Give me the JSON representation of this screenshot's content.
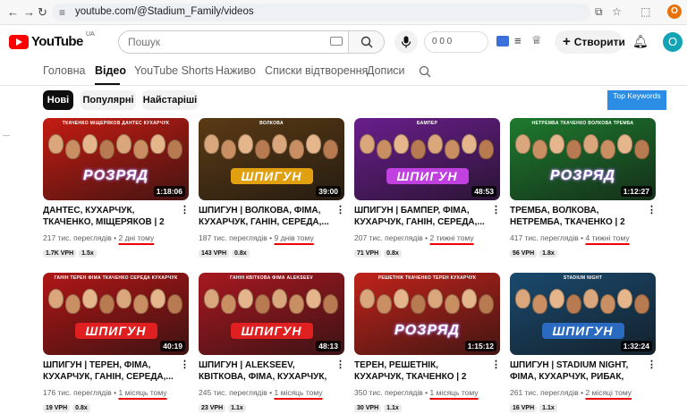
{
  "browser": {
    "url": "youtube.com/@Stadium_Family/videos",
    "back_icon": "←",
    "forward_icon": "→",
    "reload_icon": "↻",
    "profile_letter": "O"
  },
  "header": {
    "logo_text": "YouTube",
    "country": "UA",
    "search_placeholder": "Пошук",
    "counters": "0 0 0",
    "create_label": "Створити",
    "avatar_letter": "O"
  },
  "tabs": [
    {
      "label": "Головна"
    },
    {
      "label": "Відео"
    },
    {
      "label": "YouTube Shorts"
    },
    {
      "label": "Наживо"
    },
    {
      "label": "Списки відтворення"
    },
    {
      "label": "Дописи"
    }
  ],
  "chips": [
    {
      "label": "Нові"
    },
    {
      "label": "Популярні"
    },
    {
      "label": "Найстаріші"
    }
  ],
  "top_keywords_label": "Top Keywords",
  "colors": {
    "accent_red": "#ff0000",
    "underline": "#e00000",
    "keywords_blue": "#2b8de4"
  },
  "videos": [
    {
      "title": "ДАНТЕС, КУХАРЧУК, ТКАЧЕНКО, МІЩЕРЯКОВ | 2 СЕЗОН | 14...",
      "views": "217 тис. переглядів",
      "ago": "2 дні тому",
      "vph": "1.7K VPH",
      "ratio": "1.5x",
      "duration": "1:18:06",
      "thumb_logo": "РОЗРЯД",
      "thumb_names": "ТКАЧЕНКО  МІЩЕРЯКОВ  ДАНТЕС  КУХАРЧУК",
      "thumb_bg": "#c41c12",
      "logo_bg": "#6d3ab0"
    },
    {
      "title": "ШПИГУН | ВОЛКОВА, ФІМА, КУХАРЧУК, ГАНІН, СЕРЕДА,...",
      "views": "187 тис. переглядів",
      "ago": "9 днів тому",
      "vph": "143 VPH",
      "ratio": "0.8x",
      "duration": "39:00",
      "thumb_logo": "ШПИГУН",
      "thumb_names": "ВОЛКОВА",
      "thumb_bg": "#5a3a14",
      "logo_bg": "#e0a010"
    },
    {
      "title": "ШПИГУН | БАМПЕР, ФІМА, КУХАРЧУК, ГАНІН, СЕРЕДА,...",
      "views": "207 тис. переглядів",
      "ago": "2 тижні тому",
      "vph": "71 VPH",
      "ratio": "0.8x",
      "duration": "48:53",
      "thumb_logo": "ШПИГУН",
      "thumb_names": "БАМПЕР",
      "thumb_bg": "#6a1e8c",
      "logo_bg": "#c040e0"
    },
    {
      "title": "ТРЕМБА, ВОЛКОВА, НЕТРЕМБА, ТКАЧЕНКО | 2 СЕЗОН | 13 ВИПУСК",
      "views": "417 тис. переглядів",
      "ago": "4 тижні тому",
      "vph": "56 VPH",
      "ratio": "1.8x",
      "duration": "1:12:27",
      "thumb_logo": "РОЗРЯД",
      "thumb_names": "НЕТРЕМБА  ТКАЧЕНКО  ВОЛКОВА  ТРЕМБА",
      "thumb_bg": "#1e7a2e",
      "logo_bg": "#6d3ab0"
    },
    {
      "title": "ШПИГУН | ТЕРЕН, ФІМА, КУХАРЧУК, ГАНІН, СЕРЕДА,...",
      "views": "176 тис. переглядів",
      "ago": "1 місяць тому",
      "vph": "19 VPH",
      "ratio": "0.8x",
      "duration": "40:19",
      "thumb_logo": "ШПИГУН",
      "thumb_names": "ГАНІН  ТЕРЕН  ФІМА  ТКАЧЕНКО  СЕРЕДА  КУХАРЧУК",
      "thumb_bg": "#b01616",
      "logo_bg": "#e02020"
    },
    {
      "title": "ШПИГУН | ALEKSEEV, КВІТКОВА, ФІМА, КУХАРЧУК, ГАНІН, СЕРЕД...",
      "views": "245 тис. переглядів",
      "ago": "1 місяць тому",
      "vph": "23 VPH",
      "ratio": "1.1x",
      "duration": "48:13",
      "thumb_logo": "ШПИГУН",
      "thumb_names": "ГАНІН  КВІТКОВА  ФІМА  ALEKSEEV",
      "thumb_bg": "#a81820",
      "logo_bg": "#e02020"
    },
    {
      "title": "ТЕРЕН, РЕШЕТНІК, КУХАРЧУК, ТКАЧЕНКО | 2 СЕЗОН | 12 ВИПУСК",
      "views": "350 тис. переглядів",
      "ago": "1 місяць тому",
      "vph": "30 VPH",
      "ratio": "1.1x",
      "duration": "1:15:12",
      "thumb_logo": "РОЗРЯД",
      "thumb_names": "РЕШЕТНІК  ТКАЧЕНКО  ТЕРЕН  КУХАРЧУК",
      "thumb_bg": "#c0231a",
      "logo_bg": "#6d3ab0"
    },
    {
      "title": "ШПИГУН | STADIUM NIGHT, ФІМА, КУХАРЧУК, РИБАК, ТКАЧЕНКО |...",
      "views": "261 тис. переглядів",
      "ago": "2 місяці тому",
      "vph": "16 VPH",
      "ratio": "1.1x",
      "duration": "1:32:24",
      "thumb_logo": "ШПИГУН",
      "thumb_names": "STADIUM NIGHT",
      "thumb_bg": "#1a4a6e",
      "logo_bg": "#2a6ac0"
    }
  ]
}
